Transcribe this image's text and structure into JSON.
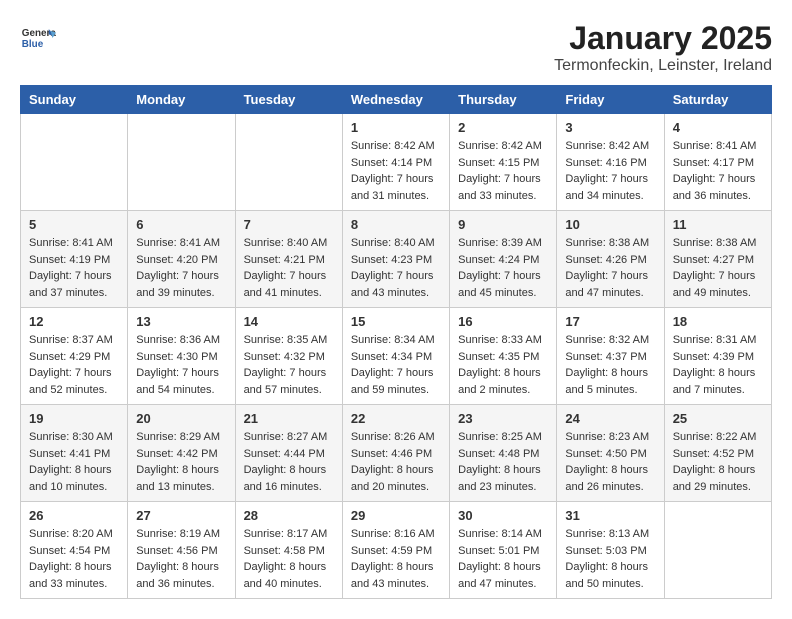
{
  "header": {
    "logo_general": "General",
    "logo_blue": "Blue",
    "month_title": "January 2025",
    "location": "Termonfeckin, Leinster, Ireland"
  },
  "days_of_week": [
    "Sunday",
    "Monday",
    "Tuesday",
    "Wednesday",
    "Thursday",
    "Friday",
    "Saturday"
  ],
  "weeks": [
    [
      {
        "day": "",
        "info": ""
      },
      {
        "day": "",
        "info": ""
      },
      {
        "day": "",
        "info": ""
      },
      {
        "day": "1",
        "info": "Sunrise: 8:42 AM\nSunset: 4:14 PM\nDaylight: 7 hours\nand 31 minutes."
      },
      {
        "day": "2",
        "info": "Sunrise: 8:42 AM\nSunset: 4:15 PM\nDaylight: 7 hours\nand 33 minutes."
      },
      {
        "day": "3",
        "info": "Sunrise: 8:42 AM\nSunset: 4:16 PM\nDaylight: 7 hours\nand 34 minutes."
      },
      {
        "day": "4",
        "info": "Sunrise: 8:41 AM\nSunset: 4:17 PM\nDaylight: 7 hours\nand 36 minutes."
      }
    ],
    [
      {
        "day": "5",
        "info": "Sunrise: 8:41 AM\nSunset: 4:19 PM\nDaylight: 7 hours\nand 37 minutes."
      },
      {
        "day": "6",
        "info": "Sunrise: 8:41 AM\nSunset: 4:20 PM\nDaylight: 7 hours\nand 39 minutes."
      },
      {
        "day": "7",
        "info": "Sunrise: 8:40 AM\nSunset: 4:21 PM\nDaylight: 7 hours\nand 41 minutes."
      },
      {
        "day": "8",
        "info": "Sunrise: 8:40 AM\nSunset: 4:23 PM\nDaylight: 7 hours\nand 43 minutes."
      },
      {
        "day": "9",
        "info": "Sunrise: 8:39 AM\nSunset: 4:24 PM\nDaylight: 7 hours\nand 45 minutes."
      },
      {
        "day": "10",
        "info": "Sunrise: 8:38 AM\nSunset: 4:26 PM\nDaylight: 7 hours\nand 47 minutes."
      },
      {
        "day": "11",
        "info": "Sunrise: 8:38 AM\nSunset: 4:27 PM\nDaylight: 7 hours\nand 49 minutes."
      }
    ],
    [
      {
        "day": "12",
        "info": "Sunrise: 8:37 AM\nSunset: 4:29 PM\nDaylight: 7 hours\nand 52 minutes."
      },
      {
        "day": "13",
        "info": "Sunrise: 8:36 AM\nSunset: 4:30 PM\nDaylight: 7 hours\nand 54 minutes."
      },
      {
        "day": "14",
        "info": "Sunrise: 8:35 AM\nSunset: 4:32 PM\nDaylight: 7 hours\nand 57 minutes."
      },
      {
        "day": "15",
        "info": "Sunrise: 8:34 AM\nSunset: 4:34 PM\nDaylight: 7 hours\nand 59 minutes."
      },
      {
        "day": "16",
        "info": "Sunrise: 8:33 AM\nSunset: 4:35 PM\nDaylight: 8 hours\nand 2 minutes."
      },
      {
        "day": "17",
        "info": "Sunrise: 8:32 AM\nSunset: 4:37 PM\nDaylight: 8 hours\nand 5 minutes."
      },
      {
        "day": "18",
        "info": "Sunrise: 8:31 AM\nSunset: 4:39 PM\nDaylight: 8 hours\nand 7 minutes."
      }
    ],
    [
      {
        "day": "19",
        "info": "Sunrise: 8:30 AM\nSunset: 4:41 PM\nDaylight: 8 hours\nand 10 minutes."
      },
      {
        "day": "20",
        "info": "Sunrise: 8:29 AM\nSunset: 4:42 PM\nDaylight: 8 hours\nand 13 minutes."
      },
      {
        "day": "21",
        "info": "Sunrise: 8:27 AM\nSunset: 4:44 PM\nDaylight: 8 hours\nand 16 minutes."
      },
      {
        "day": "22",
        "info": "Sunrise: 8:26 AM\nSunset: 4:46 PM\nDaylight: 8 hours\nand 20 minutes."
      },
      {
        "day": "23",
        "info": "Sunrise: 8:25 AM\nSunset: 4:48 PM\nDaylight: 8 hours\nand 23 minutes."
      },
      {
        "day": "24",
        "info": "Sunrise: 8:23 AM\nSunset: 4:50 PM\nDaylight: 8 hours\nand 26 minutes."
      },
      {
        "day": "25",
        "info": "Sunrise: 8:22 AM\nSunset: 4:52 PM\nDaylight: 8 hours\nand 29 minutes."
      }
    ],
    [
      {
        "day": "26",
        "info": "Sunrise: 8:20 AM\nSunset: 4:54 PM\nDaylight: 8 hours\nand 33 minutes."
      },
      {
        "day": "27",
        "info": "Sunrise: 8:19 AM\nSunset: 4:56 PM\nDaylight: 8 hours\nand 36 minutes."
      },
      {
        "day": "28",
        "info": "Sunrise: 8:17 AM\nSunset: 4:58 PM\nDaylight: 8 hours\nand 40 minutes."
      },
      {
        "day": "29",
        "info": "Sunrise: 8:16 AM\nSunset: 4:59 PM\nDaylight: 8 hours\nand 43 minutes."
      },
      {
        "day": "30",
        "info": "Sunrise: 8:14 AM\nSunset: 5:01 PM\nDaylight: 8 hours\nand 47 minutes."
      },
      {
        "day": "31",
        "info": "Sunrise: 8:13 AM\nSunset: 5:03 PM\nDaylight: 8 hours\nand 50 minutes."
      },
      {
        "day": "",
        "info": ""
      }
    ]
  ]
}
